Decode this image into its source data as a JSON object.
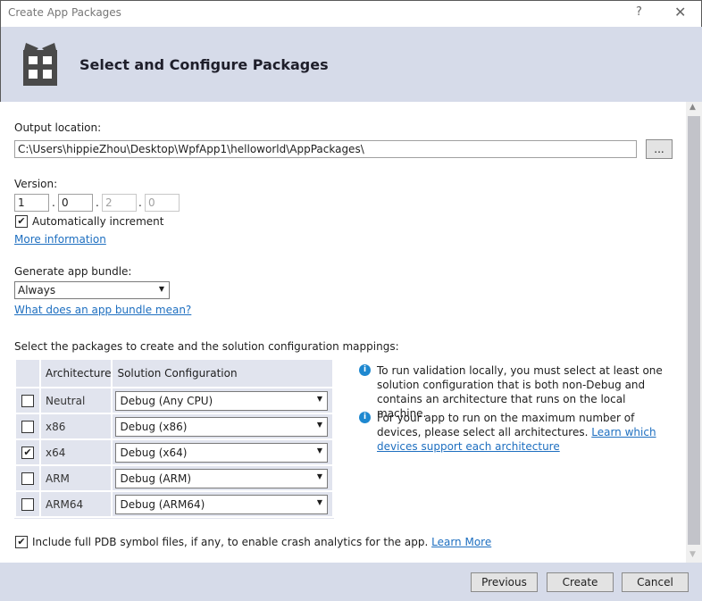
{
  "window": {
    "title": "Create App Packages",
    "help": "?",
    "close": "✕"
  },
  "header": {
    "title": "Select and Configure Packages",
    "icon": "gift-package-icon"
  },
  "output": {
    "label": "Output location:",
    "value": "C:\\Users\\hippieZhou\\Desktop\\WpfApp1\\helloworld\\AppPackages\\",
    "browse": "..."
  },
  "version": {
    "label": "Version:",
    "parts": [
      "1",
      "0",
      "2",
      "0"
    ],
    "sep": ".",
    "auto_label": "Automatically increment",
    "auto_checked": true,
    "more": "More information"
  },
  "bundle": {
    "label": "Generate app bundle:",
    "value": "Always",
    "link": "What does an app bundle mean?"
  },
  "packages": {
    "label": "Select the packages to create and the solution configuration mappings:",
    "headers": [
      "Architecture",
      "Solution Configuration"
    ],
    "rows": [
      {
        "arch": "Neutral",
        "config": "Debug (Any CPU)",
        "checked": false
      },
      {
        "arch": "x86",
        "config": "Debug (x86)",
        "checked": false
      },
      {
        "arch": "x64",
        "config": "Debug (x64)",
        "checked": true
      },
      {
        "arch": "ARM",
        "config": "Debug (ARM)",
        "checked": false
      },
      {
        "arch": "ARM64",
        "config": "Debug (ARM64)",
        "checked": false
      }
    ]
  },
  "info": {
    "note1": "To run validation locally, you must select at least one solution configuration that is both non-Debug and contains an architecture that runs on the local machine.",
    "note2": "For your app to run on the maximum number of devices, please select all architectures.",
    "note2_link": "Learn which devices support each architecture"
  },
  "pdb": {
    "label": "Include full PDB symbol files, if any, to enable crash analytics for the app.",
    "link": "Learn More",
    "checked": true
  },
  "footer": {
    "previous": "Previous",
    "create": "Create",
    "cancel": "Cancel"
  }
}
